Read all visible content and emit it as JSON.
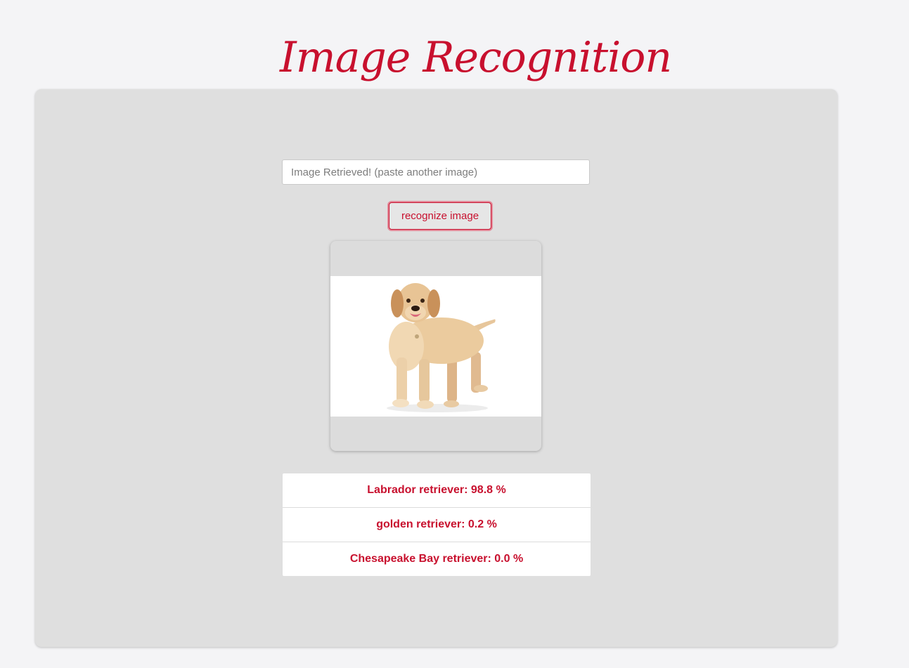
{
  "header": {
    "title": "Image Recognition"
  },
  "form": {
    "url_placeholder": "Image Retrieved! (paste another image)",
    "url_value": "",
    "recognize_label": "recognize image"
  },
  "image": {
    "subject": "dog-photo"
  },
  "results": [
    {
      "label": "Labrador retriever: 98.8 %"
    },
    {
      "label": "golden retriever: 0.2 %"
    },
    {
      "label": "Chesapeake Bay retriever: 0.0 %"
    }
  ],
  "colors": {
    "accent": "#c8102e",
    "page_background": "#f4f4f6",
    "panel_background": "#dfdfdf",
    "result_background": "#ffffff"
  }
}
